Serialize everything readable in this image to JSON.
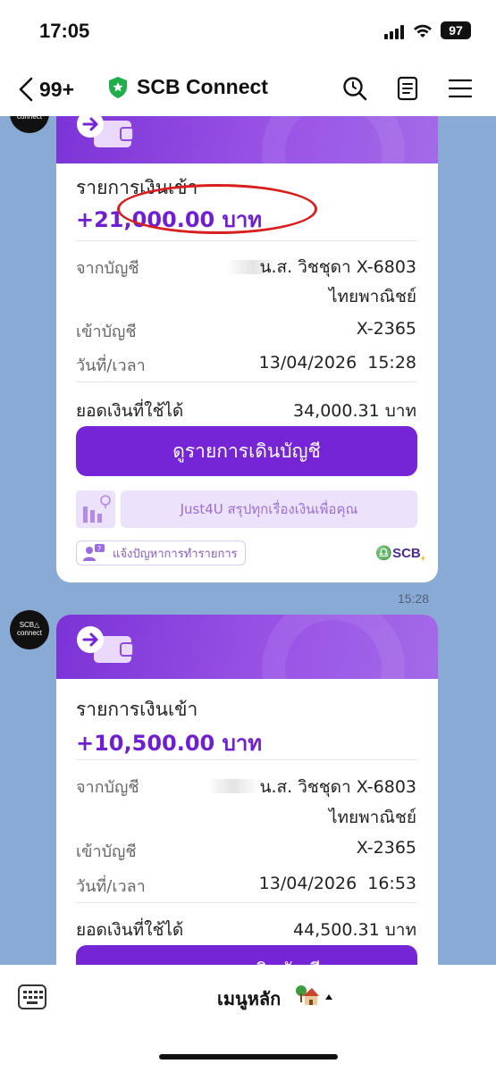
{
  "status_bar": {
    "time": "17:05",
    "battery": "97"
  },
  "header": {
    "back_count": "99+",
    "title": "SCB Connect"
  },
  "bot": {
    "avatar_text_line1": "SCB△",
    "avatar_text_line2": "connect"
  },
  "messages": [
    {
      "heading": "รายการเงินเข้า",
      "amount": "+21,000.00 บาท",
      "from_label": "จากบัญชี",
      "from_name": "น.ส. วิชชุดา X-6803",
      "from_bank": "ไทยพาณิชย์",
      "to_label": "เข้าบัญชี",
      "to_account": "X-2365",
      "datetime_label": "วันที่/เวลา",
      "datetime": "13/04/2026  15:28",
      "balance_label": "ยอดเงินที่ใช้ได้",
      "balance": "34,000.31 บาท",
      "button_label": "ดูรายการเดินบัญชี",
      "just4u": "Just4U สรุปทุกเรื่องเงินเพื่อคุณ",
      "report": "แจ้งปัญหาการทำรายการ",
      "brand": "SCB",
      "brand_suffix": "+",
      "timestamp": "15:28"
    },
    {
      "heading": "รายการเงินเข้า",
      "amount": "+10,500.00 บาท",
      "from_label": "จากบัญชี",
      "from_name": "น.ส. วิชชุดา X-6803",
      "from_bank": "ไทยพาณิชย์",
      "to_label": "เข้าบัญชี",
      "to_account": "X-2365",
      "datetime_label": "วันที่/เวลา",
      "datetime": "13/04/2026  16:53",
      "balance_label": "ยอดเงินที่ใช้ได้",
      "balance": "44,500.31 บาท",
      "button_label": "ดูรายการเดินบัญชี"
    }
  ],
  "bottom_bar": {
    "menu_label": "เมนูหลัก"
  },
  "colors": {
    "accent": "#7524d6",
    "chat_bg": "#8aaad6",
    "highlight": "#d81e1e"
  }
}
